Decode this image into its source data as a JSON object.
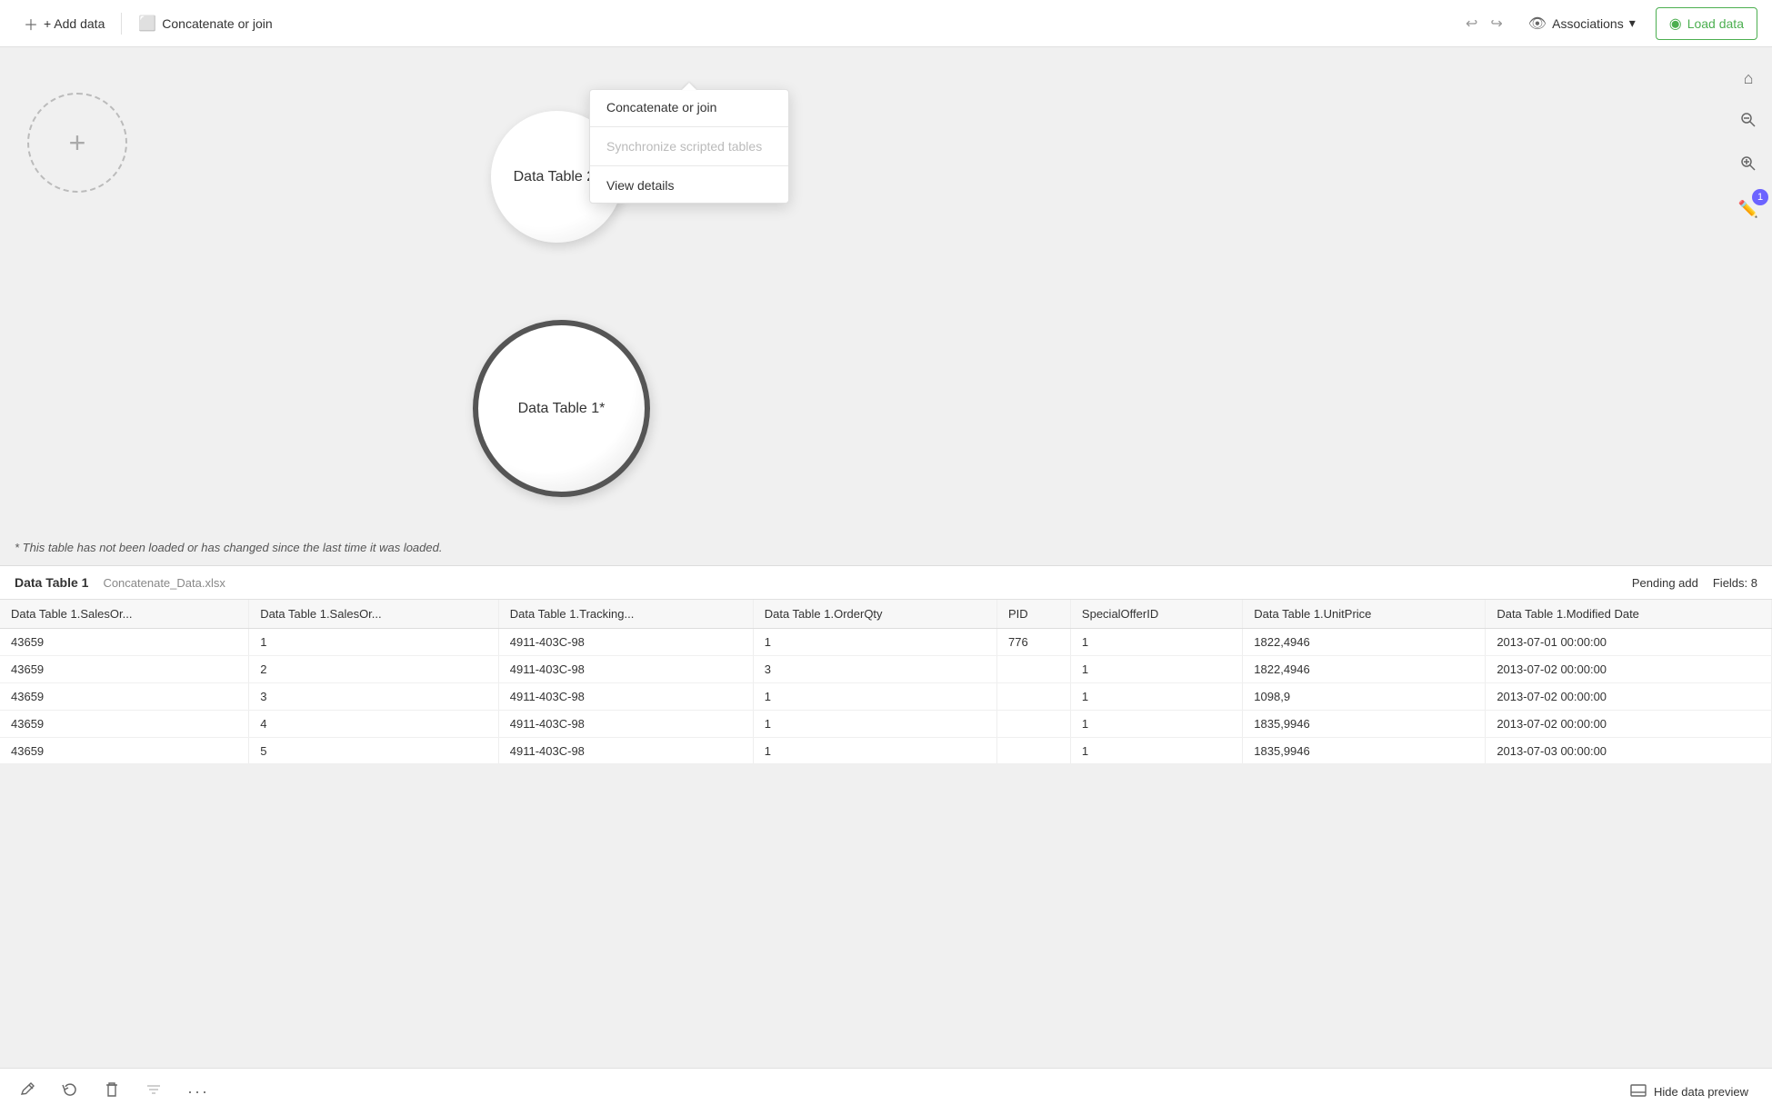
{
  "toolbar": {
    "add_data_label": "+ Add data",
    "concatenate_label": "Concatenate or join",
    "undo_icon": "↩",
    "redo_icon": "↪",
    "associations_label": "Associations",
    "associations_chevron": "▾",
    "load_data_label": "Load data",
    "load_data_icon": "▶"
  },
  "canvas": {
    "add_plus": "+",
    "table2_label": "Data Table 2*",
    "table1_label": "Data Table 1*",
    "note": "* This table has not been loaded or has changed since the last time it was loaded.",
    "controls": {
      "home_icon": "⌂",
      "zoom_out_icon": "🔍",
      "zoom_in_icon": "🔎",
      "badge_count": "1",
      "paint_icon": "✏"
    }
  },
  "preview": {
    "title": "Data Table 1",
    "subtitle": "Concatenate_Data.xlsx",
    "status": "Pending add",
    "fields_label": "Fields: 8"
  },
  "table": {
    "headers": [
      "Data Table 1.SalesOr...",
      "Data Table 1.SalesOr...",
      "Data Table 1.Tracking...",
      "Data Table 1.OrderQty",
      "PID",
      "SpecialOfferID",
      "Data Table 1.UnitPrice",
      "Data Table 1.Modified Date"
    ],
    "rows": [
      [
        "43659",
        "1",
        "4911-403C-98",
        "1",
        "776",
        "1",
        "1822,4946",
        "2013-07-01 00:00:00"
      ],
      [
        "43659",
        "2",
        "4911-403C-98",
        "3",
        "",
        "1",
        "1822,4946",
        "2013-07-02 00:00:00"
      ],
      [
        "43659",
        "3",
        "4911-403C-98",
        "1",
        "",
        "1",
        "1098,9",
        "2013-07-02 00:00:00"
      ],
      [
        "43659",
        "4",
        "4911-403C-98",
        "1",
        "",
        "1",
        "1835,9946",
        "2013-07-02 00:00:00"
      ],
      [
        "43659",
        "5",
        "4911-403C-98",
        "1",
        "",
        "1",
        "1835,9946",
        "2013-07-03 00:00:00"
      ]
    ]
  },
  "context_menu": {
    "items": [
      {
        "label": "Concatenate or join",
        "disabled": false
      },
      {
        "label": "Synchronize scripted tables",
        "disabled": true
      },
      {
        "label": "View details",
        "disabled": false
      }
    ]
  },
  "bottom_toolbar": {
    "edit_icon": "✎",
    "refresh_icon": "↻",
    "delete_icon": "🗑",
    "filter_icon": "⚙",
    "more_icon": "•••",
    "hide_preview_icon": "▭",
    "hide_preview_label": "Hide data preview"
  }
}
